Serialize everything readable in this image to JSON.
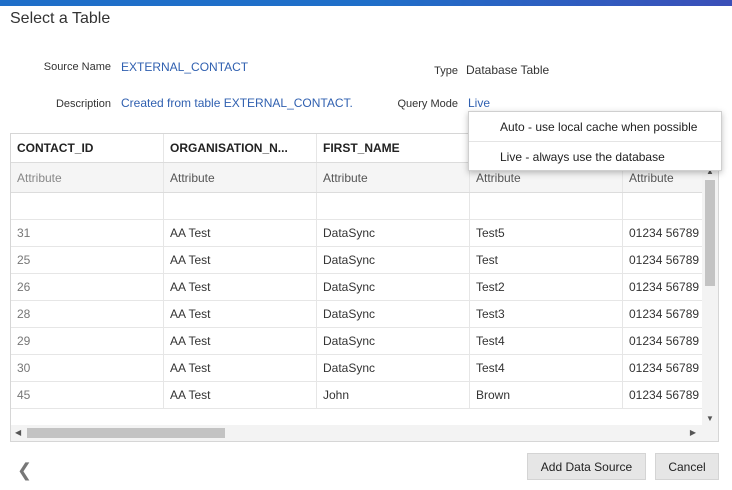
{
  "dialog": {
    "title": "Select a Table"
  },
  "fields": {
    "source_name_label": "Source Name",
    "source_name_value": "EXTERNAL_CONTACT",
    "type_label": "Type",
    "type_value": "Database Table",
    "description_label": "Description",
    "description_value": "Created from table EXTERNAL_CONTACT.",
    "query_mode_label": "Query Mode",
    "query_mode_value": "Live"
  },
  "query_mode_menu": {
    "options": [
      "Auto - use local cache when possible",
      "Live - always use the database"
    ]
  },
  "grid": {
    "columns": [
      "CONTACT_ID",
      "ORGANISATION_N...",
      "FIRST_NAME",
      "",
      ""
    ],
    "types": [
      "Attribute",
      "Attribute",
      "Attribute",
      "Attribute",
      "Attribute"
    ],
    "rows": [
      [
        "31",
        "AA Test",
        "DataSync",
        "Test5",
        "01234 56789"
      ],
      [
        "25",
        "AA Test",
        "DataSync",
        "Test",
        "01234 56789"
      ],
      [
        "26",
        "AA Test",
        "DataSync",
        "Test2",
        "01234 56789"
      ],
      [
        "28",
        "AA Test",
        "DataSync",
        "Test3",
        "01234 56789"
      ],
      [
        "29",
        "AA Test",
        "DataSync",
        "Test4",
        "01234 56789"
      ],
      [
        "30",
        "AA Test",
        "DataSync",
        "Test4",
        "01234 56789"
      ],
      [
        "45",
        "AA Test",
        "John",
        "Brown",
        "01234 56789"
      ]
    ]
  },
  "footer": {
    "add_label": "Add Data Source",
    "cancel_label": "Cancel"
  },
  "icons": {
    "back": "chevron-left-icon",
    "scroll_up": "arrow-up-icon",
    "scroll_down": "arrow-down-icon",
    "scroll_left": "arrow-left-icon",
    "scroll_right": "arrow-right-icon"
  },
  "colors": {
    "accent": "#1f6fc9",
    "link": "#3060b0"
  }
}
